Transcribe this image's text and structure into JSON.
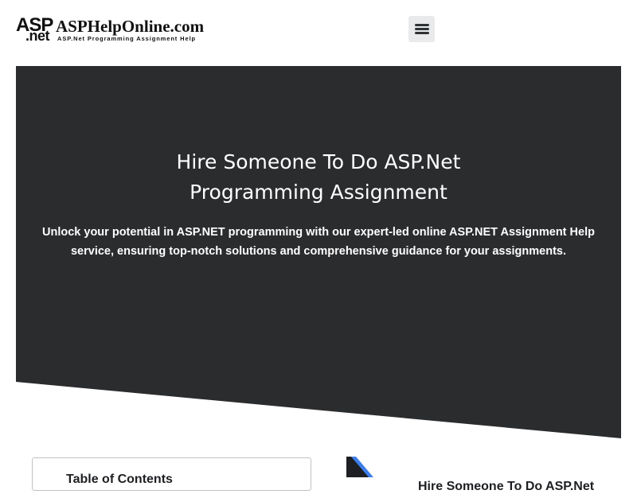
{
  "header": {
    "logo": {
      "mark_top": "ASP",
      "mark_bottom": ".net",
      "site_name": "ASPHelpOnline.com",
      "tagline": "ASP.Net Programming Assignment Help"
    },
    "menu_icon": "hamburger-icon"
  },
  "hero": {
    "title_line1": "Hire Someone To Do ASP.Net",
    "title_line2": "Programming Assignment",
    "subtitle": "Unlock your potential in ASP.NET programming with our expert-led online ASP.NET Assignment Help service, ensuring top-notch solutions and comprehensive guidance for your assignments.",
    "background_color": "#2b2c2e"
  },
  "below": {
    "card_heading": "Table of Contents",
    "section_title": "Hire Someone To Do ASP.Net",
    "accent_color": "#3d7ee8"
  }
}
